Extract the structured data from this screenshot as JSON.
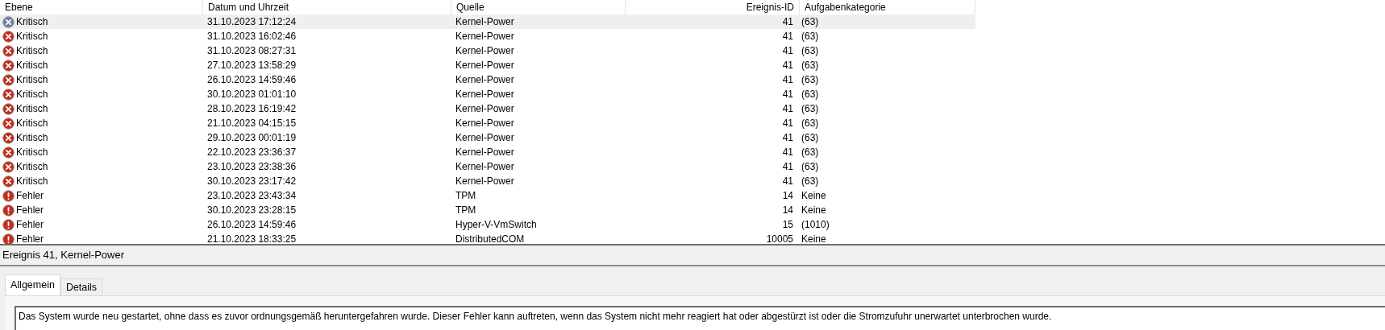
{
  "columns": [
    "Ebene",
    "Datum und Uhrzeit",
    "Quelle",
    "Ereignis-ID",
    "Aufgabenkategorie"
  ],
  "rows": [
    {
      "kind": "critical",
      "level": "Kritisch",
      "date": "31.10.2023 17:12:24",
      "source": "Kernel-Power",
      "id": "41",
      "category": "(63)",
      "selected": true
    },
    {
      "kind": "critical",
      "level": "Kritisch",
      "date": "31.10.2023 16:02:46",
      "source": "Kernel-Power",
      "id": "41",
      "category": "(63)",
      "selected": false
    },
    {
      "kind": "critical",
      "level": "Kritisch",
      "date": "31.10.2023 08:27:31",
      "source": "Kernel-Power",
      "id": "41",
      "category": "(63)",
      "selected": false
    },
    {
      "kind": "critical",
      "level": "Kritisch",
      "date": "27.10.2023 13:58:29",
      "source": "Kernel-Power",
      "id": "41",
      "category": "(63)",
      "selected": false
    },
    {
      "kind": "critical",
      "level": "Kritisch",
      "date": "26.10.2023 14:59:46",
      "source": "Kernel-Power",
      "id": "41",
      "category": "(63)",
      "selected": false
    },
    {
      "kind": "critical",
      "level": "Kritisch",
      "date": "30.10.2023 01:01:10",
      "source": "Kernel-Power",
      "id": "41",
      "category": "(63)",
      "selected": false
    },
    {
      "kind": "critical",
      "level": "Kritisch",
      "date": "28.10.2023 16:19:42",
      "source": "Kernel-Power",
      "id": "41",
      "category": "(63)",
      "selected": false
    },
    {
      "kind": "critical",
      "level": "Kritisch",
      "date": "21.10.2023 04:15:15",
      "source": "Kernel-Power",
      "id": "41",
      "category": "(63)",
      "selected": false
    },
    {
      "kind": "critical",
      "level": "Kritisch",
      "date": "29.10.2023 00:01:19",
      "source": "Kernel-Power",
      "id": "41",
      "category": "(63)",
      "selected": false
    },
    {
      "kind": "critical",
      "level": "Kritisch",
      "date": "22.10.2023 23:36:37",
      "source": "Kernel-Power",
      "id": "41",
      "category": "(63)",
      "selected": false
    },
    {
      "kind": "critical",
      "level": "Kritisch",
      "date": "23.10.2023 23:38:36",
      "source": "Kernel-Power",
      "id": "41",
      "category": "(63)",
      "selected": false
    },
    {
      "kind": "critical",
      "level": "Kritisch",
      "date": "30.10.2023 23:17:42",
      "source": "Kernel-Power",
      "id": "41",
      "category": "(63)",
      "selected": false
    },
    {
      "kind": "error",
      "level": "Fehler",
      "date": "23.10.2023 23:43:34",
      "source": "TPM",
      "id": "14",
      "category": "Keine",
      "selected": false
    },
    {
      "kind": "error",
      "level": "Fehler",
      "date": "30.10.2023 23:28:15",
      "source": "TPM",
      "id": "14",
      "category": "Keine",
      "selected": false
    },
    {
      "kind": "error",
      "level": "Fehler",
      "date": "26.10.2023 14:59:46",
      "source": "Hyper-V-VmSwitch",
      "id": "15",
      "category": "(1010)",
      "selected": false
    },
    {
      "kind": "error",
      "level": "Fehler",
      "date": "21.10.2023 18:33:25",
      "source": "DistributedCOM",
      "id": "10005",
      "category": "Keine",
      "selected": false
    }
  ],
  "detail": {
    "title": "Ereignis 41, Kernel-Power",
    "tabs": [
      {
        "label": "Allgemein",
        "selected": true
      },
      {
        "label": "Details",
        "selected": false
      }
    ],
    "description": "Das System wurde neu gestartet, ohne dass es zuvor ordnungsgemäß heruntergefahren wurde. Dieser Fehler kann auftreten, wenn das System nicht mehr reagiert hat oder abgestürzt ist oder die Stromzufuhr unerwartet unterbrochen wurde."
  }
}
